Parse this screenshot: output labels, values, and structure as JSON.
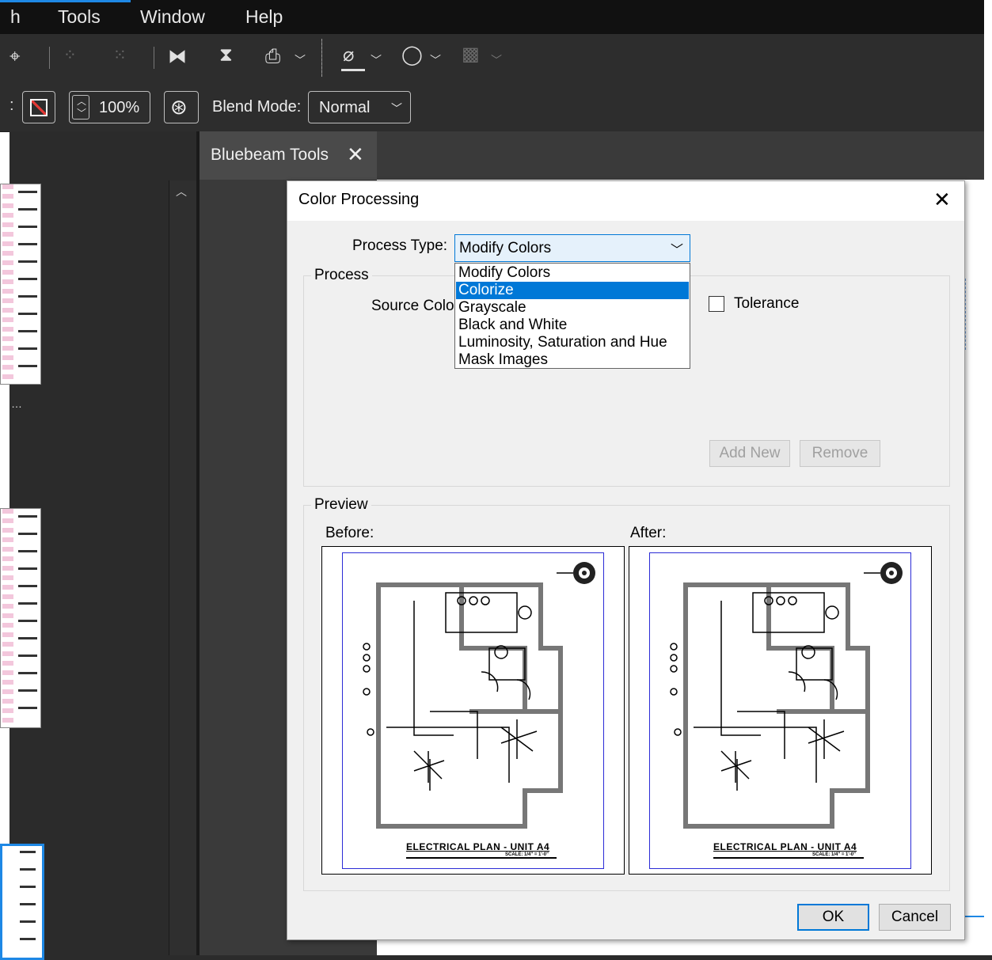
{
  "menu": {
    "items": [
      "h",
      "Tools",
      "Window",
      "Help"
    ]
  },
  "toolbar2": {
    "opacity": "100%",
    "blend_label": "Blend Mode:",
    "blend_value": "Normal"
  },
  "tabs": [
    {
      "label": "Bluebeam Tools"
    }
  ],
  "dialog": {
    "title": "Color Processing",
    "process_type_label": "Process Type:",
    "process_type_value": "Modify Colors",
    "options": [
      "Modify Colors",
      "Colorize",
      "Grayscale",
      "Black and White",
      "Luminosity, Saturation and Hue",
      "Mask Images"
    ],
    "selected_option": "Colorize",
    "process_group": "Process",
    "source_color_label": "Source Color",
    "tolerance_label": "Tolerance",
    "add_new": "Add New",
    "remove": "Remove",
    "preview_group": "Preview",
    "before_label": "Before:",
    "after_label": "After:",
    "plan_caption": "ELECTRICAL PLAN - UNIT A4",
    "plan_scale": "SCALE: 1/4\" = 1'-0\"",
    "ok": "OK",
    "cancel": "Cancel"
  }
}
